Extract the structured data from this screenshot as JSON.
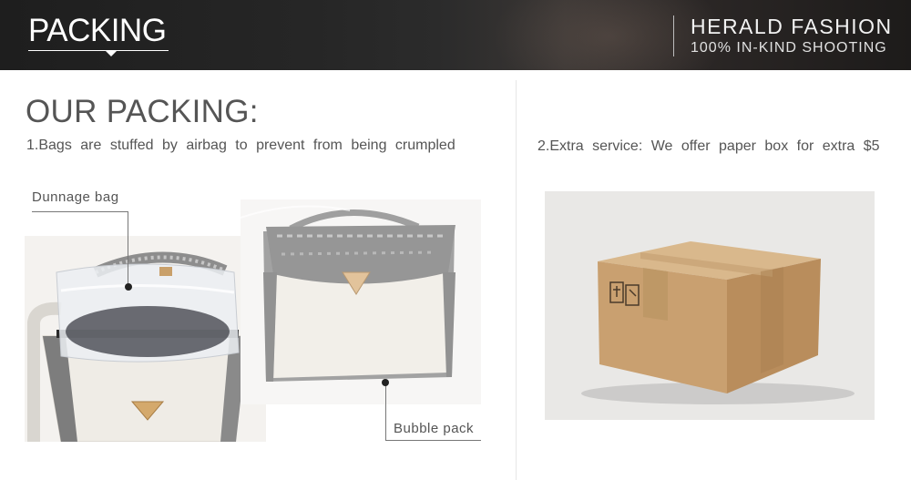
{
  "header": {
    "title": "PACKING",
    "brand_name": "HERALD FASHION",
    "brand_tagline": "100% IN-KIND SHOOTING"
  },
  "section": {
    "heading": "OUR PACKING:",
    "caption_left": "1.Bags are stuffed by airbag to prevent from being crumpled",
    "caption_right": "2.Extra service: We offer paper box for extra $5"
  },
  "callouts": {
    "dunnage": "Dunnage bag",
    "bubble": "Bubble pack"
  },
  "colors": {
    "banner_bg": "#262626",
    "text": "#555555",
    "cardboard": "#c9a478"
  }
}
